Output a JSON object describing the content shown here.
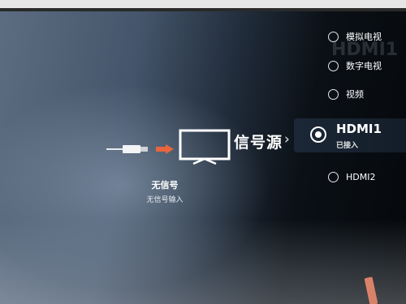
{
  "source_menu": {
    "title": "信号源",
    "items": [
      {
        "label": "模拟电视",
        "selected": false
      },
      {
        "label": "数字电视",
        "selected": false
      },
      {
        "label": "视频",
        "selected": false
      },
      {
        "label": "HDMI1",
        "sublabel": "已接入",
        "selected": true
      },
      {
        "label": "HDMI2",
        "selected": false
      }
    ]
  },
  "status": {
    "title": "无信号",
    "subtitle": "无信号输入"
  },
  "watermark": "HDMI1",
  "colors": {
    "arrow": "#e8663d",
    "selected_bg": "#1c2838"
  },
  "icons": [
    "hdmi-plug-icon",
    "arrow-right-icon",
    "tv-icon",
    "chevron-right-icon",
    "radio-icon"
  ]
}
